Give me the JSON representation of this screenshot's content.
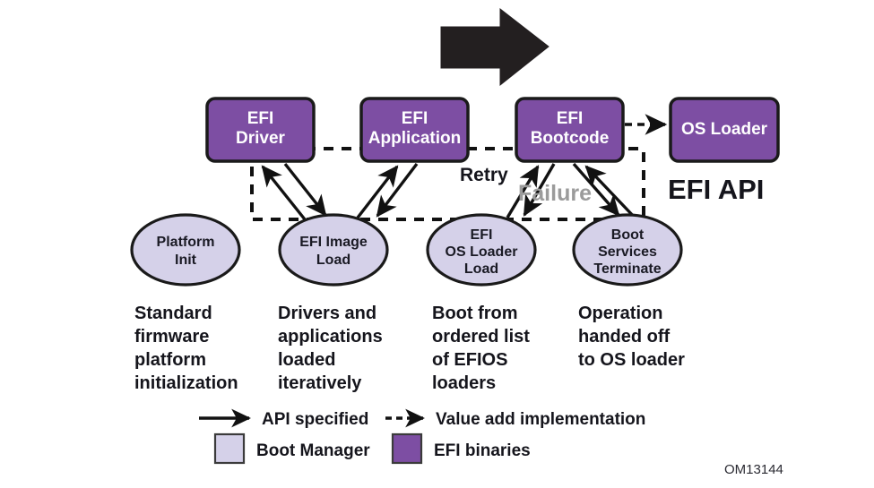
{
  "figure": {
    "doc_id": "OM13144",
    "api_title": "EFI API",
    "colors": {
      "efi_binary_fill": "#7d4ea3",
      "boot_manager_fill": "#d5d1e9",
      "outline": "#1a1a1a",
      "big_arrow": "#231f20",
      "failure_label": "#9b9b9b",
      "text_dark": "#15151c",
      "text_light": "#ffffff",
      "background": "#ffffff"
    }
  },
  "binaries": [
    {
      "id": "efi-driver",
      "line1": "EFI",
      "line2": "Driver"
    },
    {
      "id": "efi-application",
      "line1": "EFI",
      "line2": "Application"
    },
    {
      "id": "efi-bootcode",
      "line1": "EFI",
      "line2": "Bootcode"
    },
    {
      "id": "os-loader",
      "line1": "OS Loader",
      "line2": ""
    }
  ],
  "stages": [
    {
      "id": "platform-init",
      "lines": [
        "Platform",
        "Init"
      ],
      "caption": [
        "Standard",
        "firmware",
        "platform",
        "initialization"
      ]
    },
    {
      "id": "efi-image-load",
      "lines": [
        "EFI Image",
        "Load"
      ],
      "caption": [
        "Drivers and",
        "applications",
        "loaded",
        "iteratively"
      ]
    },
    {
      "id": "efi-os-loader-load",
      "lines": [
        "EFI",
        "OS Loader",
        "Load"
      ],
      "caption": [
        "Boot from",
        "ordered list",
        "of EFIOS",
        "loaders"
      ]
    },
    {
      "id": "boot-services-terminate",
      "lines": [
        "Boot",
        "Services",
        "Terminate"
      ],
      "caption": [
        "Operation",
        "handed off",
        "to OS loader"
      ]
    }
  ],
  "flow_labels": {
    "retry": "Retry",
    "failure": "Failure"
  },
  "legend": {
    "api_specified": "API specified",
    "value_add": "Value add implementation",
    "boot_manager": "Boot Manager",
    "efi_binaries": "EFI binaries"
  }
}
